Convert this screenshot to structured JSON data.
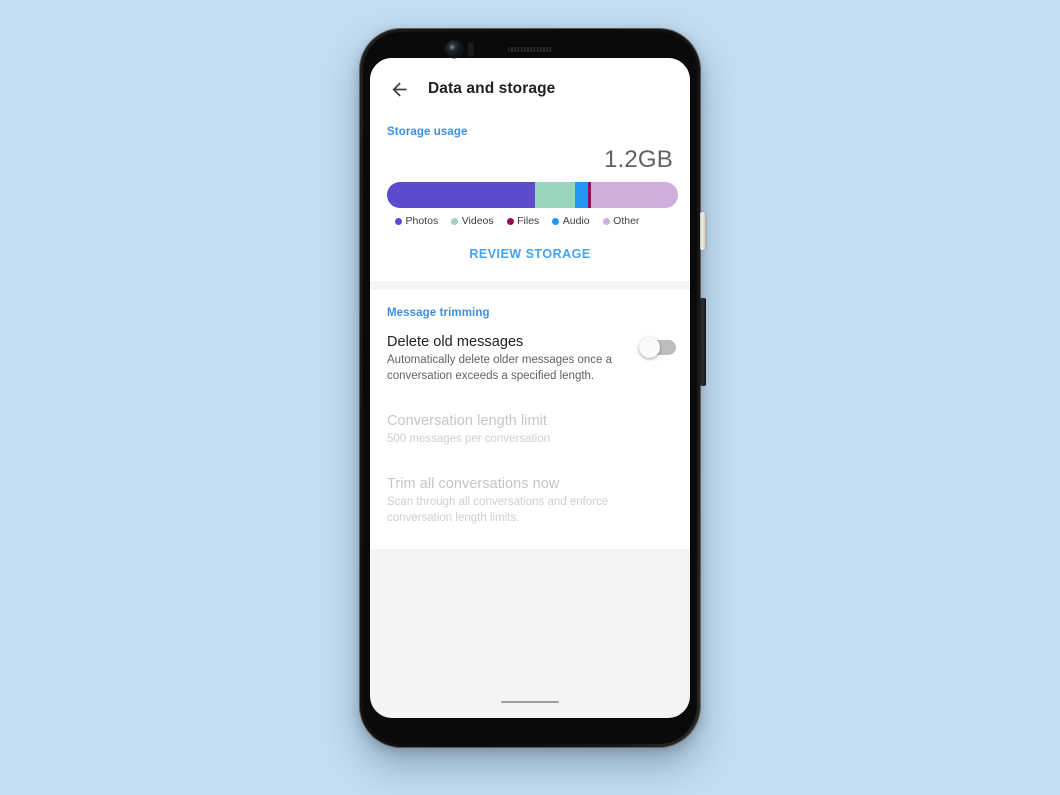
{
  "background_color": "#c2dcf0",
  "device": {
    "frame_color": "#111111",
    "power_button_name": "power-button",
    "volume_button_name": "volume-button"
  },
  "app_bar": {
    "back_icon": "arrow-left-icon",
    "title": "Data and storage"
  },
  "storage_section": {
    "header": "Storage usage",
    "total": "1.2GB",
    "review_button": "REVIEW STORAGE",
    "legend": [
      {
        "label": "Photos",
        "color": "#5c4ccd"
      },
      {
        "label": "Videos",
        "color": "#9ad4bd"
      },
      {
        "label": "Files",
        "color": "#8e0c52"
      },
      {
        "label": "Audio",
        "color": "#2196f3"
      },
      {
        "label": "Other",
        "color": "#cfaedd"
      }
    ]
  },
  "chart_data": {
    "type": "bar",
    "orientation": "horizontal-stacked",
    "title": "Storage usage",
    "total_label": "1.2GB",
    "unit": "percent of total",
    "categories": [
      "Photos",
      "Videos",
      "Audio",
      "Files",
      "Other"
    ],
    "values": [
      51.0,
      13.5,
      4.5,
      1.0,
      30.0
    ],
    "colors": [
      "#5c4ccd",
      "#9ad4bd",
      "#2196f3",
      "#8e0c52",
      "#cfaedd"
    ],
    "legend_position": "below",
    "grid": false,
    "xlabel": "",
    "ylabel": ""
  },
  "trimming_section": {
    "header": "Message trimming",
    "rows": [
      {
        "title": "Delete old messages",
        "subtitle": "Automatically delete older messages once a conversation exceeds a specified length.",
        "enabled": true,
        "toggle_on": false
      },
      {
        "title": "Conversation length limit",
        "subtitle": "500 messages per conversation",
        "enabled": false
      },
      {
        "title": "Trim all conversations now",
        "subtitle": "Scan through all conversations and enforce conversation length limits.",
        "enabled": false
      }
    ]
  }
}
